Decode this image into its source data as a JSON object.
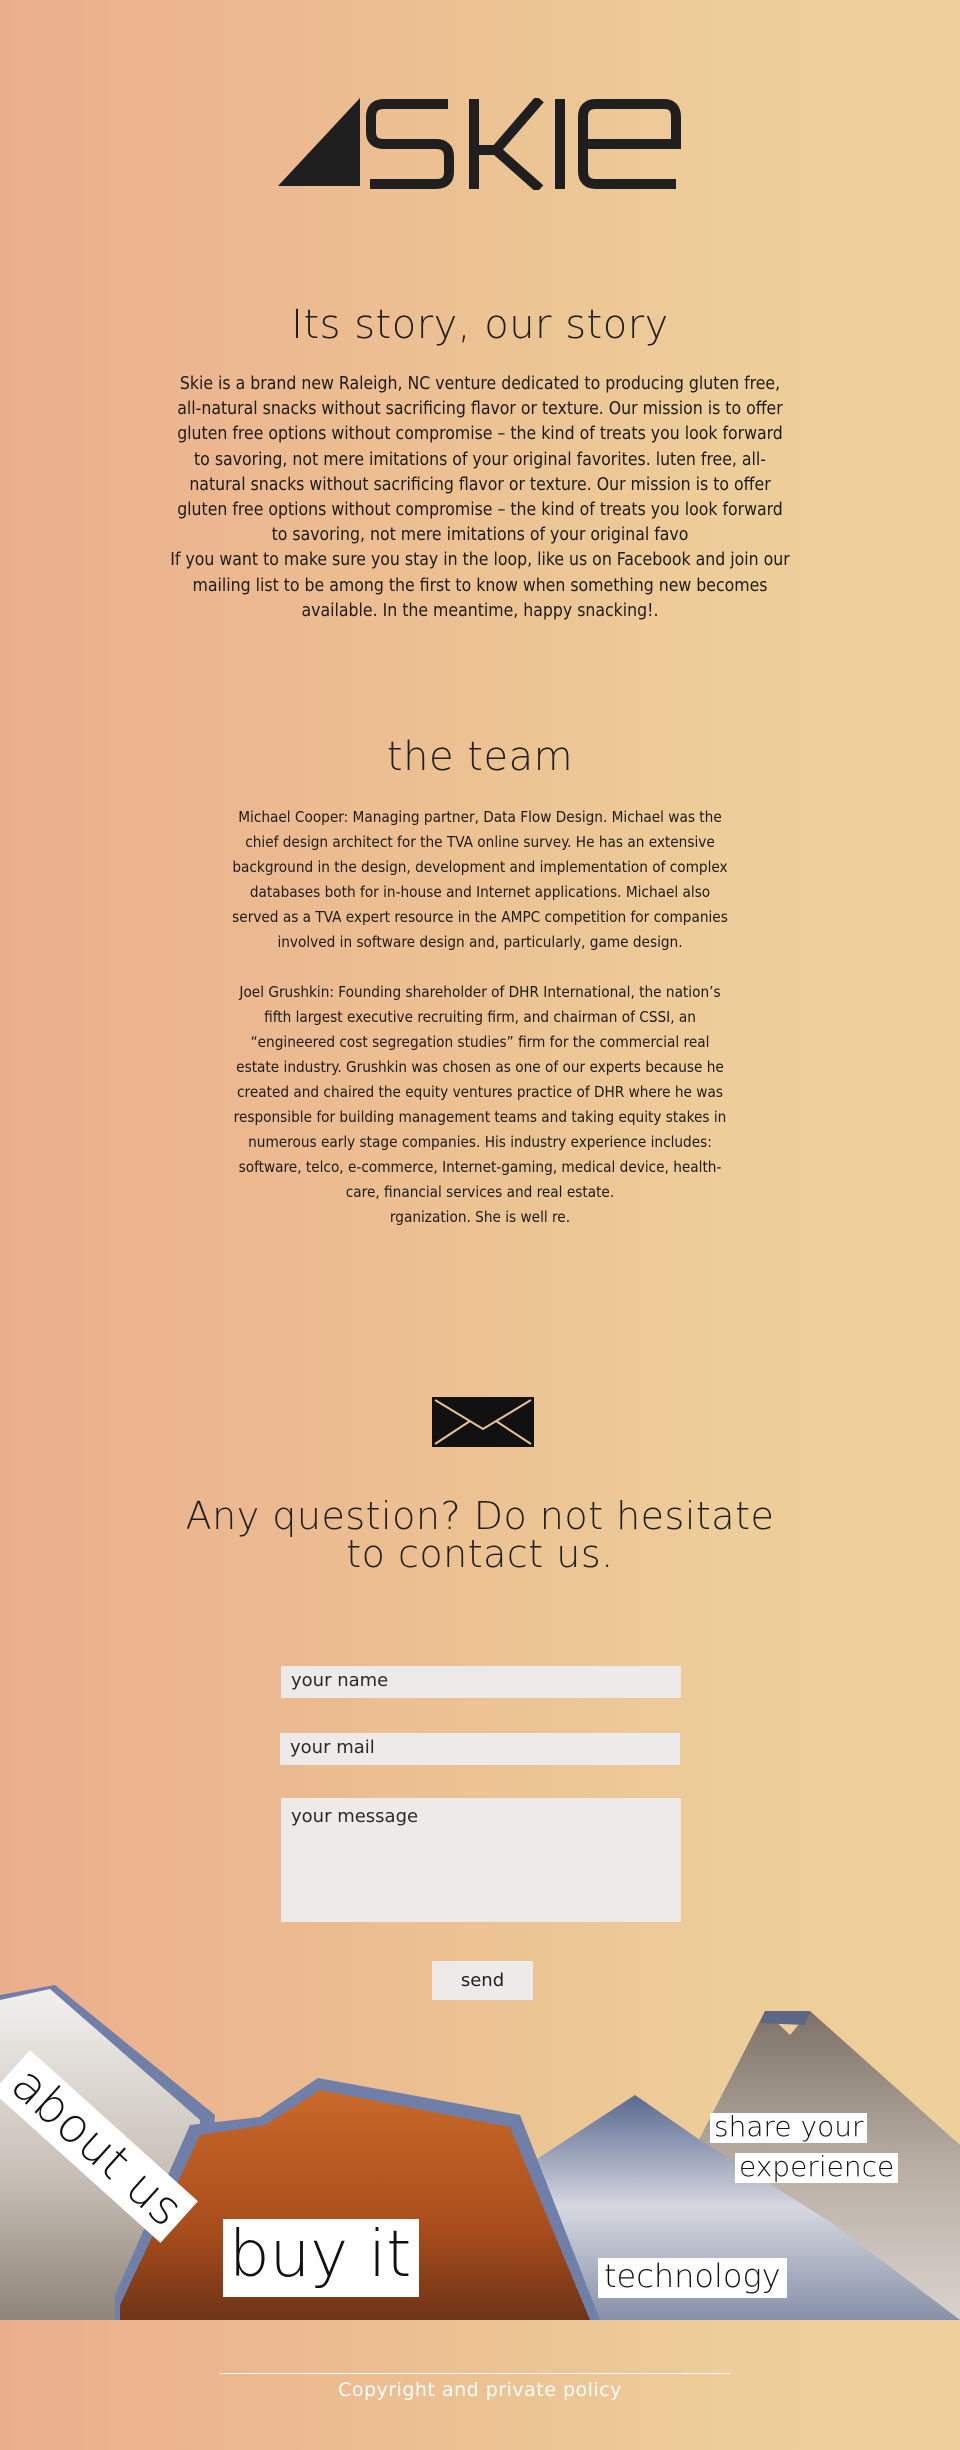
{
  "brand": {
    "logo_text": "SKIE"
  },
  "story": {
    "title": "Its story, our story",
    "paragraphs": [
      "Skie is a brand new Raleigh, NC  venture dedicated to producing gluten free, all-natural snacks without sacrificing flavor or texture. Our mission is to offer gluten free options without compromise – the kind of treats you look forward to savoring, not mere imitations of your original favorites. luten free, all-natural snacks without sacrificing flavor or texture. Our mission is to offer gluten free options without compromise – the kind of treats you look forward to savoring, not mere imitations of your original favo",
      "If you want to make sure you stay in the loop, like us on Facebook and join our mailing list to be among the first to know when something new becomes available. In the meantime, happy snacking!."
    ]
  },
  "team": {
    "title": "the team",
    "members": [
      "Michael Cooper: Managing partner, Data Flow Design. Michael was the chief design architect for the TVA online survey. He has an extensive background in the design, development and implementation of complex databases both for in-house and Internet applications. Michael also served as a TVA expert resource in the AMPC competition for companies involved in software design and, particularly, game design.",
      "Joel Grushkin: Founding shareholder of DHR International, the nation’s fifth largest executive recruiting firm, and chairman of CSSI, an “engineered cost segregation studies” firm for the commercial real estate industry. Grushkin was chosen as one of our experts because he created and chaired the equity ventures practice of DHR where he was responsible for building management teams and taking equity stakes in numerous early stage companies. His industry experience includes: software, telco, e-commerce, Internet-gaming, medical device, health-care, financial services and real estate.\nrganization. She is well re."
    ]
  },
  "contact": {
    "icon": "envelope-icon",
    "title_line1": "Any question? Do not hesitate",
    "title_line2": "to contact us.",
    "name_placeholder": "your name",
    "mail_placeholder": "your mail",
    "message_placeholder": "your message",
    "send_label": "send"
  },
  "nav": {
    "about": "about us",
    "buy": "buy it",
    "share_line1": "share your",
    "share_line2": "experience",
    "technology": "technology"
  },
  "footer": {
    "text": "Copyright and private policy"
  },
  "colors": {
    "text": "#1f1f1f",
    "field_bg": "#eeeaea",
    "label_bg": "#ffffff",
    "footer_text": "#ffffff"
  }
}
